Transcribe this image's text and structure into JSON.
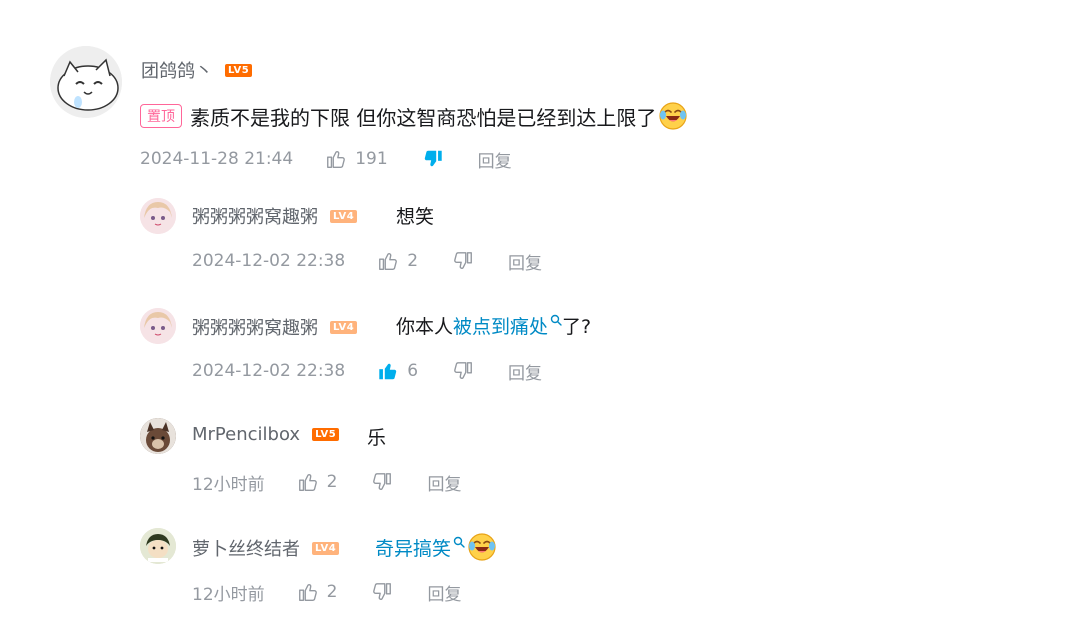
{
  "colors": {
    "username": "#61666d",
    "text": "#18191c",
    "meta": "#9499a0",
    "link": "#008ac5",
    "accent_blue": "#00aeec",
    "pin": "#ff6699",
    "lv5": "#ff6c00",
    "lv4": "#ffb37c"
  },
  "main_comment": {
    "username": "团鸽鸽丶",
    "level": "LV5",
    "pin_label": "置顶",
    "text": "素质不是我的下限 但你这智商恐怕是已经到达上限了",
    "emoji": "laughing-crying-emoji",
    "date": "2024-11-28 21:44",
    "likes": "191",
    "dislike_active": true,
    "reply_label": "回复"
  },
  "replies": [
    {
      "username": "粥粥粥粥窝趣粥",
      "level": "LV4",
      "text": "想笑",
      "date": "2024-12-02 22:38",
      "likes": "2",
      "liked": false,
      "reply_label": "回复"
    },
    {
      "username": "粥粥粥粥窝趣粥",
      "level": "LV4",
      "text_before": "你本人",
      "link_text": "被点到痛处",
      "text_after": "了?",
      "date": "2024-12-02 22:38",
      "likes": "6",
      "liked": true,
      "reply_label": "回复"
    },
    {
      "username": "MrPencilbox",
      "level": "LV5",
      "text": "乐",
      "date": "12小时前",
      "likes": "2",
      "liked": false,
      "reply_label": "回复"
    },
    {
      "username": "萝卜丝终结者",
      "level": "LV4",
      "link_text": "奇异搞笑",
      "emoji": "laughing-crying-emoji",
      "date": "12小时前",
      "likes": "2",
      "liked": false,
      "reply_label": "回复"
    }
  ]
}
